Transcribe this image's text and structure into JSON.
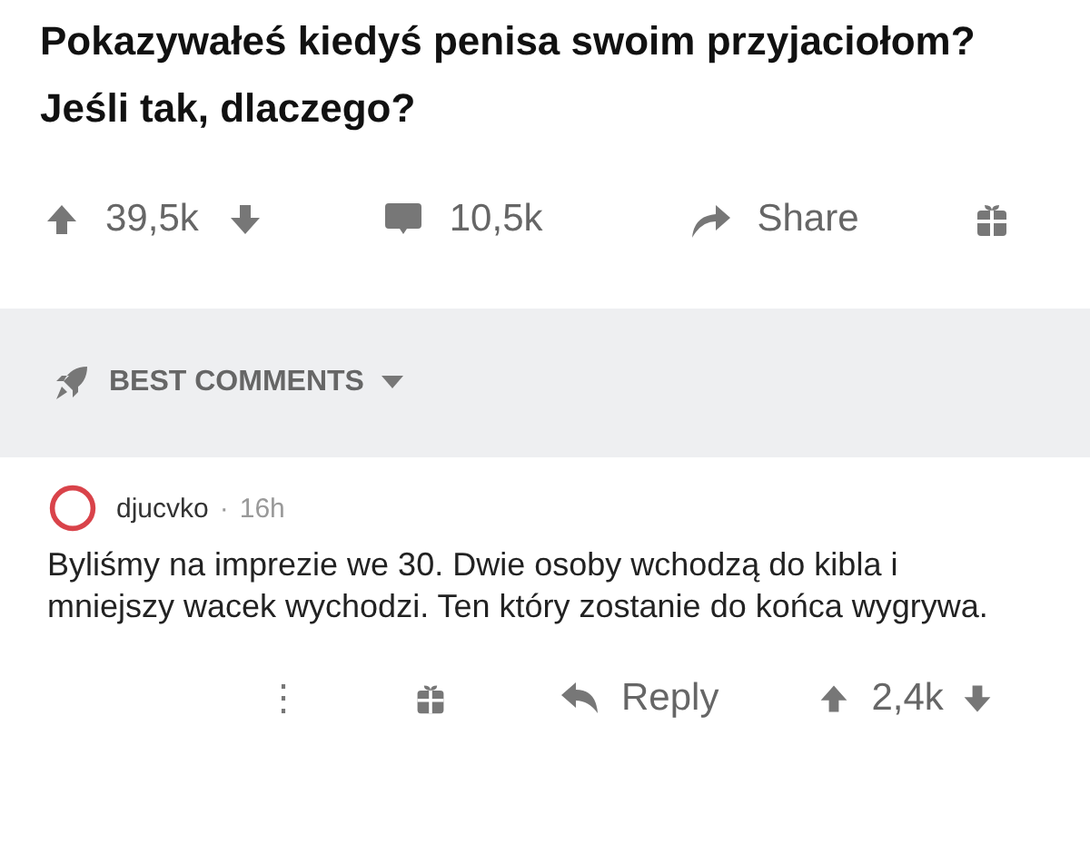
{
  "post": {
    "title": "Pokazywałeś kiedyś penisa swoim przyjaciołom? Jeśli tak, dlaczego?"
  },
  "actions": {
    "upvotes": "39,5k",
    "comments": "10,5k",
    "share": "Share"
  },
  "comments_header": {
    "label": "BEST COMMENTS"
  },
  "comment": {
    "author": "djucvko",
    "separator": "·",
    "time": "16h",
    "text": "Byliśmy na imprezie we 30. Dwie osoby wchodzą do kibla i mniejszy wacek wychodzi. Ten który zostanie do końca wygrywa.",
    "more": "⋮",
    "reply": "Reply",
    "votes": "2,4k"
  }
}
